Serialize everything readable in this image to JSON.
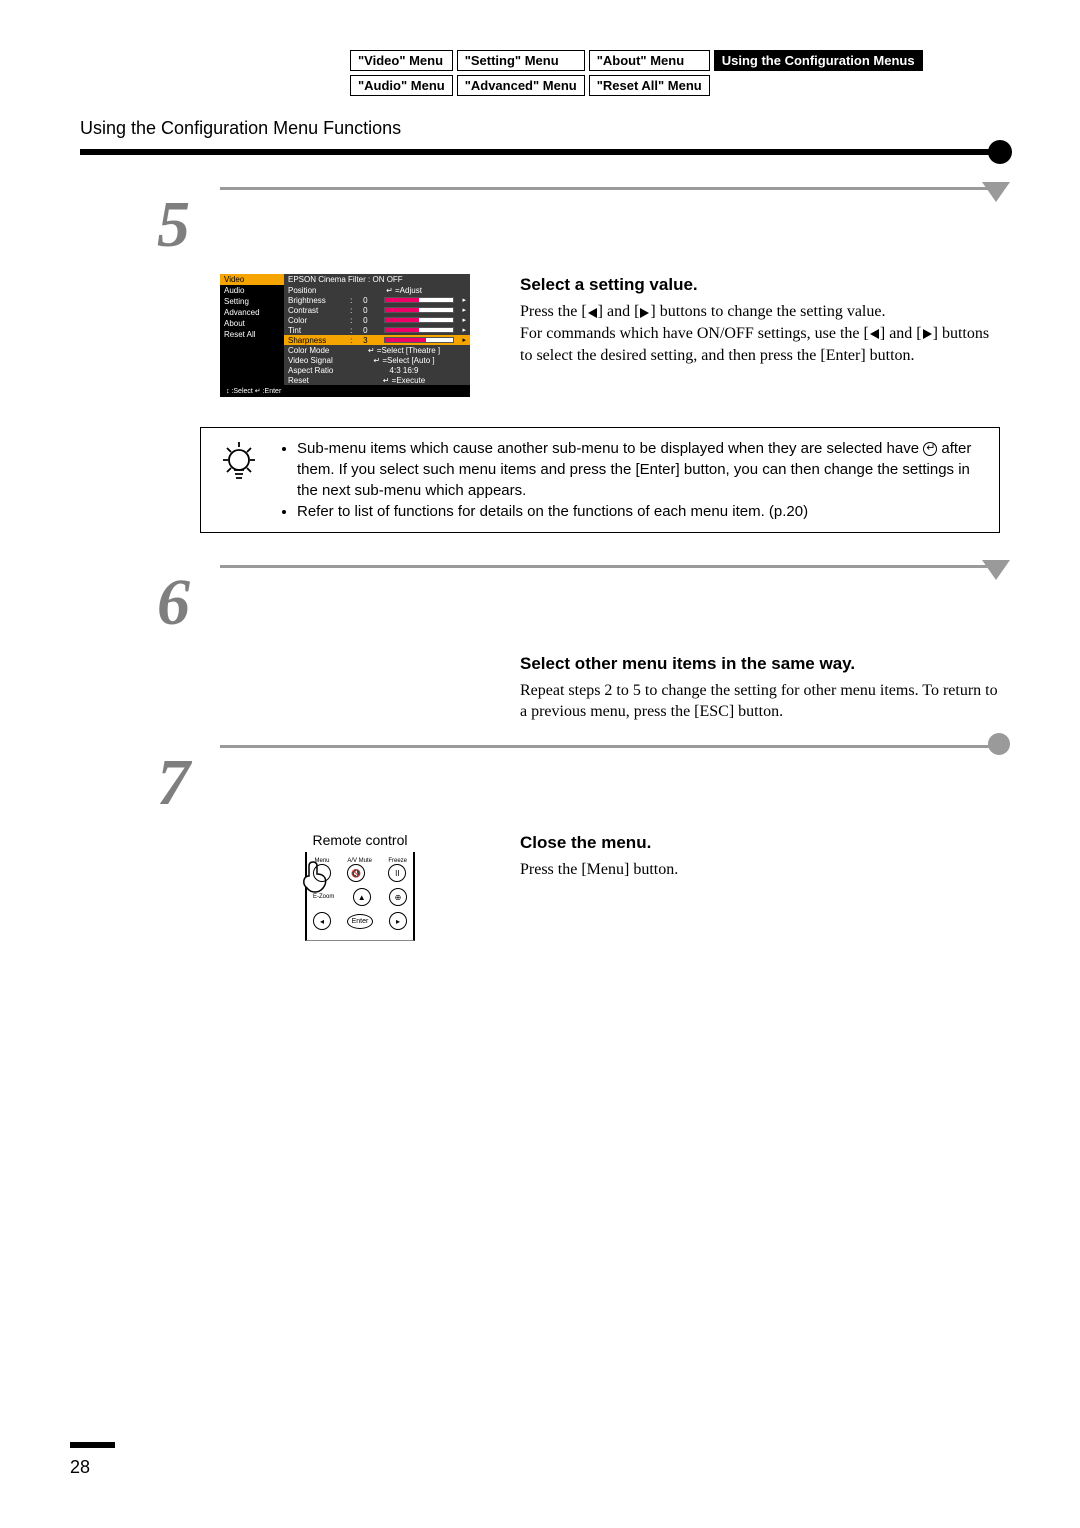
{
  "nav": {
    "row1": [
      "\"Video\" Menu",
      "\"Setting\" Menu",
      "\"About\" Menu",
      "Using the Configuration Menus"
    ],
    "row2": [
      "\"Audio\" Menu",
      "\"Advanced\" Menu",
      "\"Reset All\" Menu"
    ],
    "active_index_row1": 3
  },
  "section_title": "Using the Configuration Menu Functions",
  "step5": {
    "num": "5",
    "heading": "Select a setting value.",
    "body_a": "Press the [",
    "body_b": "] and [",
    "body_c": "] buttons to change the setting value.",
    "body2_a": "For commands which have ON/OFF settings, use the [",
    "body2_b": "] and [",
    "body2_c": "] buttons to select the desired setting, and then press the [Enter] button.",
    "osd": {
      "left": [
        "Video",
        "Audio",
        "Setting",
        "Advanced",
        "About",
        "Reset All"
      ],
      "left_sel_index": 0,
      "header": "EPSON Cinema Filter :  ON   OFF",
      "rows": [
        {
          "label": "Position",
          "extra": "↵ =Adjust",
          "type": "action"
        },
        {
          "label": "Brightness",
          "val": "0",
          "type": "slider"
        },
        {
          "label": "Contrast",
          "val": "0",
          "type": "slider"
        },
        {
          "label": "Color",
          "val": "0",
          "type": "slider"
        },
        {
          "label": "Tint",
          "val": "0",
          "type": "slider"
        },
        {
          "label": "Sharpness",
          "val": "3",
          "type": "slider",
          "selected": true
        },
        {
          "label": "Color Mode",
          "extra": "↵ =Select [Theatre      ]",
          "type": "action"
        },
        {
          "label": "Video Signal",
          "extra": "↵ =Select [Auto           ]",
          "type": "action"
        },
        {
          "label": "Aspect Ratio",
          "extra": "  4:3        16:9",
          "type": "action"
        },
        {
          "label": "Reset",
          "extra": "↵ =Execute",
          "type": "action"
        }
      ],
      "footer": "↕ :Select   ↵ :Enter"
    }
  },
  "tip": {
    "bullet1": "Sub-menu items which cause another sub-menu to be displayed when they are selected have ",
    "bullet1b": " after them. If you select such menu items and press the [Enter] button, you can then change the settings in the next sub-menu which appears.",
    "bullet2": "Refer to list of functions for details on the functions of each menu item. (p.20)"
  },
  "step6": {
    "num": "6",
    "heading": "Select other menu items in the same way.",
    "body": "Repeat steps 2 to 5 to change the setting for other menu items. To return to a previous menu, press the [ESC] button."
  },
  "step7": {
    "num": "7",
    "heading": "Close the menu.",
    "body": "Press the [Menu] button.",
    "remote_label": "Remote control",
    "remote": {
      "top_labels": [
        "Menu",
        "A/V Mute",
        "Freeze"
      ],
      "ezoom_label": "E-Zoom",
      "enter_label": "Enter",
      "pause_glyph": "II",
      "mute_icon": "🔇"
    }
  },
  "page_number": "28"
}
